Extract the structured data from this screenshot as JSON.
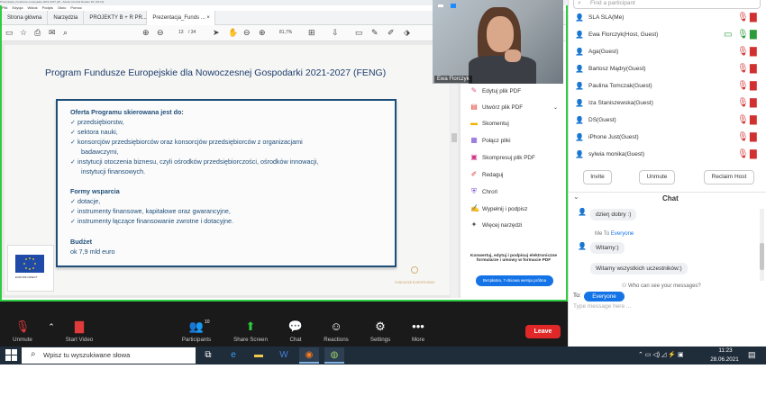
{
  "pdf": {
    "title_bar": "Prezentacja_Fundusze europejskie 2021-2027.pdf - Adobe Acrobat Reader DC (64-bit)",
    "menu": [
      "Plik",
      "Edycja",
      "Widok",
      "Podpis",
      "Okno",
      "Pomoc"
    ],
    "tabs": [
      "Strona główna",
      "Narzędzia",
      "PROJEKTY B + R PR...",
      "Prezentacja_Funds ..."
    ],
    "page_current": "13",
    "page_total": "/ 34",
    "zoom": "81,7%",
    "tools": [
      {
        "label": "Edytuj plik PDF",
        "icon": "edit-pdf-icon",
        "glyph": "✎",
        "color": "#e05a8a"
      },
      {
        "label": "Utwórz plik PDF",
        "icon": "create-pdf-icon",
        "glyph": "▤",
        "color": "#e0443a"
      },
      {
        "label": "Skomentuj",
        "icon": "comment-icon",
        "glyph": "▬",
        "color": "#f2b400"
      },
      {
        "label": "Połącz pliki",
        "icon": "combine-files-icon",
        "glyph": "▦",
        "color": "#7a4fd0"
      },
      {
        "label": "Skompresuj plik PDF",
        "icon": "compress-pdf-icon",
        "glyph": "▣",
        "color": "#d0368a"
      },
      {
        "label": "Redaguj",
        "icon": "redact-icon",
        "glyph": "✐",
        "color": "#e0443a"
      },
      {
        "label": "Chroń",
        "icon": "protect-icon",
        "glyph": "⛨",
        "color": "#7a4fd0"
      },
      {
        "label": "Wypełnij i podpisz",
        "icon": "fill-sign-icon",
        "glyph": "✍",
        "color": "#7a4fd0"
      },
      {
        "label": "Więcej narzędzi",
        "icon": "more-tools-icon",
        "glyph": "✦",
        "color": "#555555"
      }
    ],
    "promo_text": "Konwertuj, edytuj i podpisuj elektroniczne formularze i umowy w formacie PDF",
    "trial_button": "Bezpłatna, 7-dniowa wersja próbna"
  },
  "slide": {
    "title": "Program Fundusze Europejskie dla Nowoczesnej Gospodarki 2021-2027 (FENG)",
    "offer_heading": "Oferta Programu skierowana jest do:",
    "offer_items": [
      "✓  przedsiębiorstw,",
      "✓  sektora nauki,",
      "✓  konsorcjów przedsiębiorców oraz konsorcjów przedsiębiorców z organizacjami",
      "badawczymi,",
      "✓  instytucji otoczenia biznesu, czyli ośrodków przedsiębiorczości, ośrodków innowacji,",
      "instytucji finansowych."
    ],
    "support_heading": "Formy wsparcia",
    "support_items": [
      "✓  dotacje,",
      "✓  instrumenty finansowe, kapitałowe oraz gwarancyjne,",
      "✓  instrumenty łączące finansowanie zwrotne i dotacyjne."
    ],
    "budget_heading": "Budżet",
    "budget_value": "ok 7,9 mld euro",
    "eu_logo_text": "EUROPE DIRECT",
    "fund_logo_text": "FUNDUSZE EUROPEJSKIE"
  },
  "video": {
    "name": "Ewa Florczyk"
  },
  "toolbar": {
    "unmute": "Unmute",
    "start_video": "Start Video",
    "participants": "Participants",
    "participants_count": "10",
    "share_screen": "Share Screen",
    "chat": "Chat",
    "reactions": "Reactions",
    "settings": "Settings",
    "more": "More",
    "leave": "Leave"
  },
  "participants": {
    "search_placeholder": "Find a participant",
    "list": [
      {
        "name": "SLA SLA(Me)"
      },
      {
        "name": "Ewa Florczyk(Host, Guest)"
      },
      {
        "name": "Aga(Guest)"
      },
      {
        "name": "Bartosz Mądry(Guest)"
      },
      {
        "name": "Paulina Tomczak(Guest)"
      },
      {
        "name": "Iza Staniszewska(Guest)"
      },
      {
        "name": "DS(Guest)"
      },
      {
        "name": "iPhone Just(Guest)"
      },
      {
        "name": "sylwia monika(Guest)"
      }
    ],
    "invite": "Invite",
    "unmute": "Unmute",
    "reclaim_host": "Reclaim Host"
  },
  "chat": {
    "title": "Chat",
    "messages": [
      {
        "text": "dzieη dobry :)"
      },
      {
        "text": "Witamy:)"
      },
      {
        "text": "Witamy wszystkich uczestników:)"
      }
    ],
    "me_to_prefix": "Me To",
    "me_to_target": "Everyone",
    "who_can_see": "Who can see your messages?",
    "to_label": "To:",
    "to_target": "Everyone",
    "input_placeholder": "Type message here ..."
  },
  "taskbar": {
    "search_text": "Wpisz tu wyszukiwane słowa",
    "time": "11:23",
    "date": "28.06.2021"
  }
}
